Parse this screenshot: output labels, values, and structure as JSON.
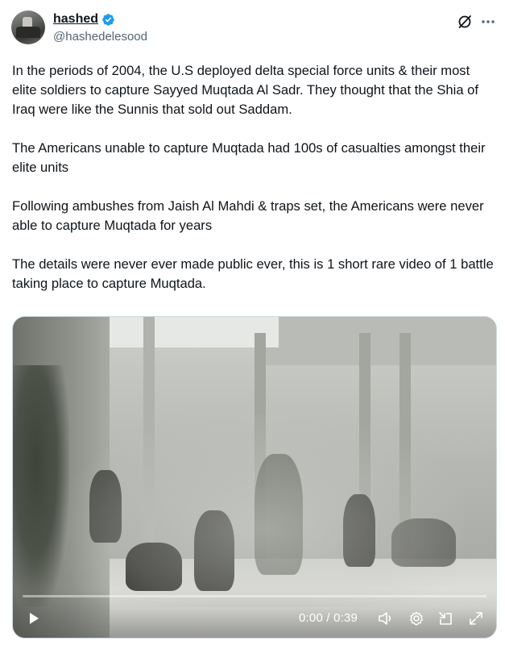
{
  "user": {
    "display_name": "hashed",
    "handle": "@hashedelesood",
    "verified": true
  },
  "tweet": {
    "paragraphs": [
      "In the periods of 2004, the U.S deployed delta special force units & their most elite soldiers to capture Sayyed Muqtada Al Sadr. They thought that the Shia of Iraq were like the Sunnis that sold out Saddam.",
      "The Americans unable to capture Muqtada had 100s of casualties amongst their elite units",
      "Following ambushes from Jaish Al Mahdi & traps set, the Americans were never able to capture Muqtada for years",
      "The details were never ever made public ever, this is 1 short rare video of 1 battle taking place to capture Muqtada."
    ]
  },
  "video": {
    "time_display": "0:00 / 0:39",
    "progress": 0
  },
  "icons": {
    "verified": "verified-badge-icon",
    "grok": "grok-icon",
    "more": "more-icon",
    "play": "play-icon",
    "volume": "volume-icon",
    "settings": "settings-icon",
    "pip": "picture-in-picture-icon",
    "fullscreen": "fullscreen-icon"
  },
  "colors": {
    "accent": "#1d9bf0",
    "text": "#0f1419",
    "secondary_text": "#536471"
  }
}
